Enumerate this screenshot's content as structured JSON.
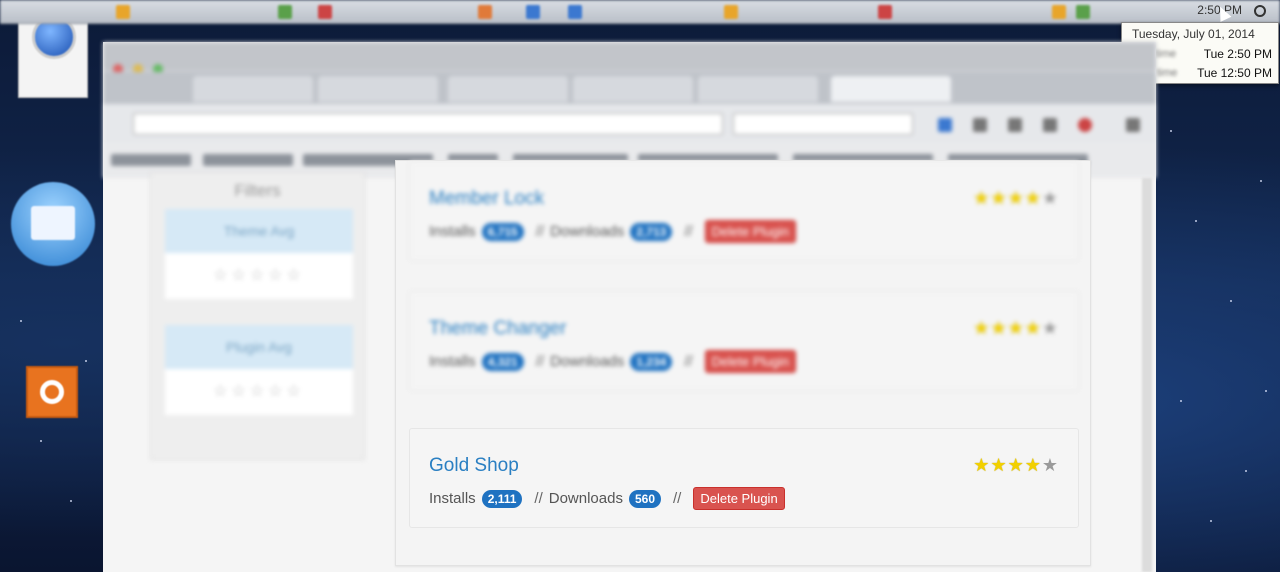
{
  "menubar": {
    "time": "2:50 PM"
  },
  "clock_popup": {
    "date": "Tuesday, July 01, 2014",
    "rows": [
      {
        "label": "Local time",
        "value": "Tue 2:50 PM"
      },
      {
        "label": "Other time",
        "value": "Tue 12:50 PM"
      }
    ]
  },
  "sidebar": {
    "title": "Filters",
    "boxes": [
      {
        "heading": "Theme Avg",
        "stars": "☆☆☆☆☆"
      },
      {
        "heading": "Plugin Avg",
        "stars": "☆☆☆☆☆"
      }
    ]
  },
  "plugins": [
    {
      "name": "Member Lock",
      "installs": "6,715",
      "downloads": "2,713",
      "delete_label": "Delete Plugin",
      "rating": 4,
      "blurred": true
    },
    {
      "name": "Theme Changer",
      "installs": "4,321",
      "downloads": "1,234",
      "delete_label": "Delete Plugin",
      "rating": 4,
      "blurred": true
    },
    {
      "name": "Gold Shop",
      "installs": "2,111",
      "downloads": "560",
      "delete_label": "Delete Plugin",
      "rating": 4,
      "blurred": false
    }
  ],
  "labels": {
    "installs": "Installs",
    "downloads": "Downloads",
    "separator": "//"
  },
  "colors": {
    "accent": "#1f72c1",
    "danger": "#d9534f",
    "title": "#2a7fc2",
    "star": "#f2d000"
  }
}
